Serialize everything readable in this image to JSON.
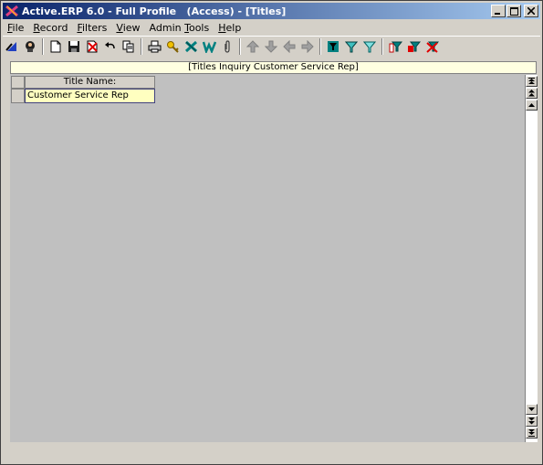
{
  "window": {
    "title": "Active.ERP 6.0 - Full Profile   (Access) - [Titles]",
    "minimize_glyph": "_",
    "restore_glyph": "□",
    "close_glyph": "✕"
  },
  "menu": {
    "items": [
      {
        "label": "File",
        "accel": "F",
        "rest": "ile"
      },
      {
        "label": "Record",
        "accel": "R",
        "rest": "ecord"
      },
      {
        "label": "Filters",
        "accel": "F",
        "rest": "ilters"
      },
      {
        "label": "View",
        "accel": "V",
        "rest": "iew"
      },
      {
        "label": "Admin Tools",
        "pre": "Admin ",
        "accel": "T",
        "rest": "ools"
      },
      {
        "label": "Help",
        "accel": "H",
        "rest": "elp"
      }
    ]
  },
  "toolbar": {
    "icons": [
      "back-icon",
      "user-icon",
      "new-document-icon",
      "save-icon",
      "delete-icon",
      "undo-icon",
      "copy-icon",
      "print-icon",
      "search-key-icon",
      "excel-icon",
      "word-icon",
      "attach-icon",
      "arrow-up-icon",
      "arrow-down-icon",
      "arrow-left-icon",
      "arrow-right-icon",
      "filter-icon",
      "filter-icon-2",
      "filter-icon-3",
      "filter-add-icon",
      "filter-edit-icon",
      "filter-remove-icon"
    ]
  },
  "inquiry": {
    "header": "[Titles Inquiry Customer Service Rep]",
    "column_header": "Title Name:",
    "rows": [
      {
        "title_name": "Customer Service Rep"
      }
    ]
  },
  "colors": {
    "titlebar_start": "#0a246a",
    "titlebar_end": "#a6caf0",
    "chrome": "#d4d0c8",
    "workspace": "#c0c0c0",
    "header_bg": "#ffffe1",
    "cell_bg": "#ffffc0"
  }
}
